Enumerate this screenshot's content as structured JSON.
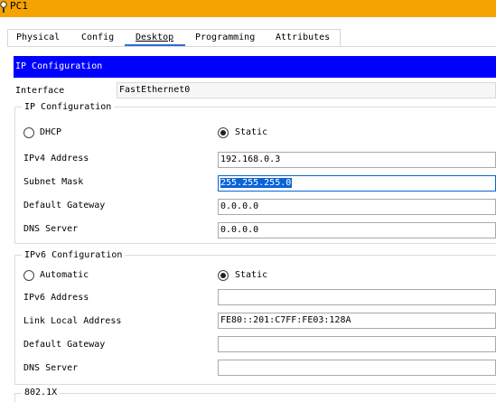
{
  "window": {
    "title": "PC1"
  },
  "tabs": [
    {
      "label": "Physical"
    },
    {
      "label": "Config"
    },
    {
      "label": "Desktop",
      "active": true
    },
    {
      "label": "Programming"
    },
    {
      "label": "Attributes"
    }
  ],
  "header": {
    "label": "IP Configuration"
  },
  "interface": {
    "label": "Interface",
    "value": "FastEthernet0"
  },
  "ipv4": {
    "legend": "IP Configuration",
    "dhcp_label": "DHCP",
    "static_label": "Static",
    "mode": "static",
    "address": {
      "label": "IPv4 Address",
      "value": "192.168.0.3"
    },
    "subnet": {
      "label": "Subnet Mask",
      "value": "255.255.255.0"
    },
    "gateway": {
      "label": "Default Gateway",
      "value": "0.0.0.0"
    },
    "dns": {
      "label": "DNS Server",
      "value": "0.0.0.0"
    }
  },
  "ipv6": {
    "legend": "IPv6 Configuration",
    "auto_label": "Automatic",
    "static_label": "Static",
    "mode": "static",
    "address": {
      "label": "IPv6 Address",
      "value": ""
    },
    "link_local": {
      "label": "Link Local Address",
      "value": "FE80::201:C7FF:FE03:128A"
    },
    "gateway": {
      "label": "Default Gateway",
      "value": ""
    },
    "dns": {
      "label": "DNS Server",
      "value": ""
    }
  },
  "dot1x": {
    "legend": "802.1X"
  },
  "colors": {
    "titlebar": "#f5a300",
    "header": "#0000ff",
    "selection": "#0a64d8",
    "tab_active": "#2a6fd8"
  },
  "icons": {
    "app": "pc-icon"
  }
}
